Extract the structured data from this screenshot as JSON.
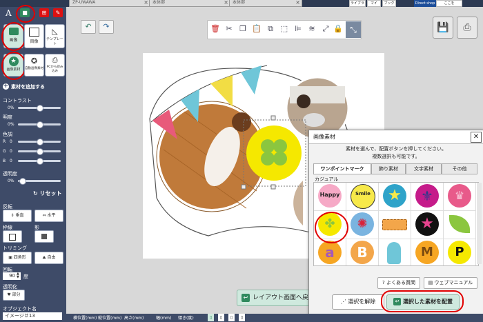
{
  "top": {
    "tabs": [
      {
        "label": "ZP-UWAWA"
      },
      {
        "label": "本体部"
      },
      {
        "label": "本体部"
      }
    ],
    "ribbon_items": [
      "ライブラ",
      "マイ",
      "ブック"
    ],
    "shop": {
      "label": "Direct shop",
      "button": "ここを"
    }
  },
  "sidebar": {
    "mode_labels": [
      "A",
      "■",
      "⊞",
      "✎"
    ],
    "tools": [
      {
        "label": "画像"
      },
      {
        "label": "目像"
      },
      {
        "label": "テンプレート"
      },
      {
        "label": "画像素材"
      },
      {
        "label": "自動画像素材"
      },
      {
        "label": "PCから読み込み"
      }
    ],
    "add_material": "素材を追加する",
    "contrast": {
      "label": "コントラスト",
      "value": "0%"
    },
    "brightness": {
      "label": "明度",
      "value": "0%"
    },
    "color": {
      "label": "色調",
      "r": "R",
      "g": "G",
      "b": "B",
      "value": "0"
    },
    "opacity": {
      "label": "透明度",
      "value": "0%"
    },
    "reset": "リセット",
    "flip": {
      "label": "反転",
      "vertical": "垂直",
      "horizontal": "水平"
    },
    "border": {
      "label": "枠線",
      "shadow": "影"
    },
    "trimming": {
      "label": "トリミング",
      "rect": "四角形",
      "free": "自由"
    },
    "rotation": {
      "label": "回転",
      "value": "90",
      "unit": "度"
    },
    "transparency": {
      "label": "透明化",
      "button": "部分"
    },
    "object_name": {
      "label": "オブジェクト名",
      "value": "イメージ＃13"
    }
  },
  "main": {
    "layout_button": "レイアウト画面へ戻"
  },
  "dialog": {
    "title": "画像素材",
    "instruction1": "素材を選んで、配置ボタンを押してください。",
    "instruction2": "複数選択も可能です。",
    "tabs": [
      "ワンポイントマーク",
      "飾り素材",
      "文字素材",
      "その他"
    ],
    "category": "カジュアル",
    "happy": "Happy",
    "smile": "Smile",
    "faq": "よくある質問",
    "manual": "ウェブマニュアル",
    "deselect": "選択を解除",
    "place": "選択した素材を配置"
  },
  "status": {
    "fields": [
      "横位置(mm)",
      "縦位置(mm)",
      "高さ(mm)",
      "幅(mm)",
      "傾き(度)"
    ]
  },
  "colors": {
    "sidebar_bg": "#3e4b68",
    "accent_green": "#2f8a5e",
    "highlight_red": "#e10000"
  }
}
